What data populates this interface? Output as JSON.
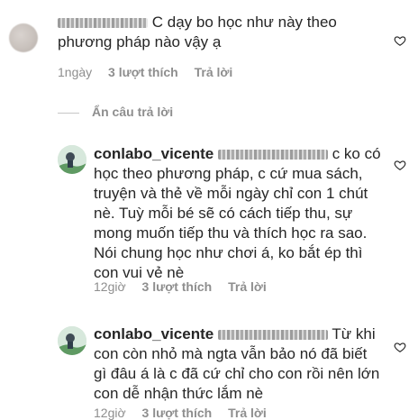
{
  "comments": [
    {
      "text": "C dạy bo học như này theo phương pháp nào vậy ạ",
      "time": "1ngày",
      "likes": "3 lượt thích",
      "reply": "Trả lời"
    },
    {
      "username": "conlabo_vicente",
      "text": "c ko có học theo phương pháp, c cứ mua sách, truyện và thẻ về mỗi ngày chỉ con 1 chút nè. Tuỳ mỗi bé sẽ có cách tiếp thu, sự mong muốn tiếp thu và thích học ra sao. Nói chung học như chơi á, ko bắt ép thì con vui vẻ nè",
      "time": "12giờ",
      "likes": "3 lượt thích",
      "reply": "Trả lời"
    },
    {
      "username": "conlabo_vicente",
      "text": "Từ khi con còn nhỏ mà ngta vẫn bảo nó đã biết gì đâu á là c đã cứ chỉ cho con rồi nên lớn con dễ nhận thức lắm nè",
      "time": "12giờ",
      "likes": "3 lượt thích",
      "reply": "Trả lời"
    }
  ],
  "hide_replies_label": "Ẩn câu trả lời",
  "icons": {
    "heart": "heart-outline-icon",
    "avatar_blurred": "avatar-blurred",
    "avatar_photo": "avatar-photo"
  },
  "colors": {
    "text": "#262626",
    "meta": "#8e8e8e"
  }
}
